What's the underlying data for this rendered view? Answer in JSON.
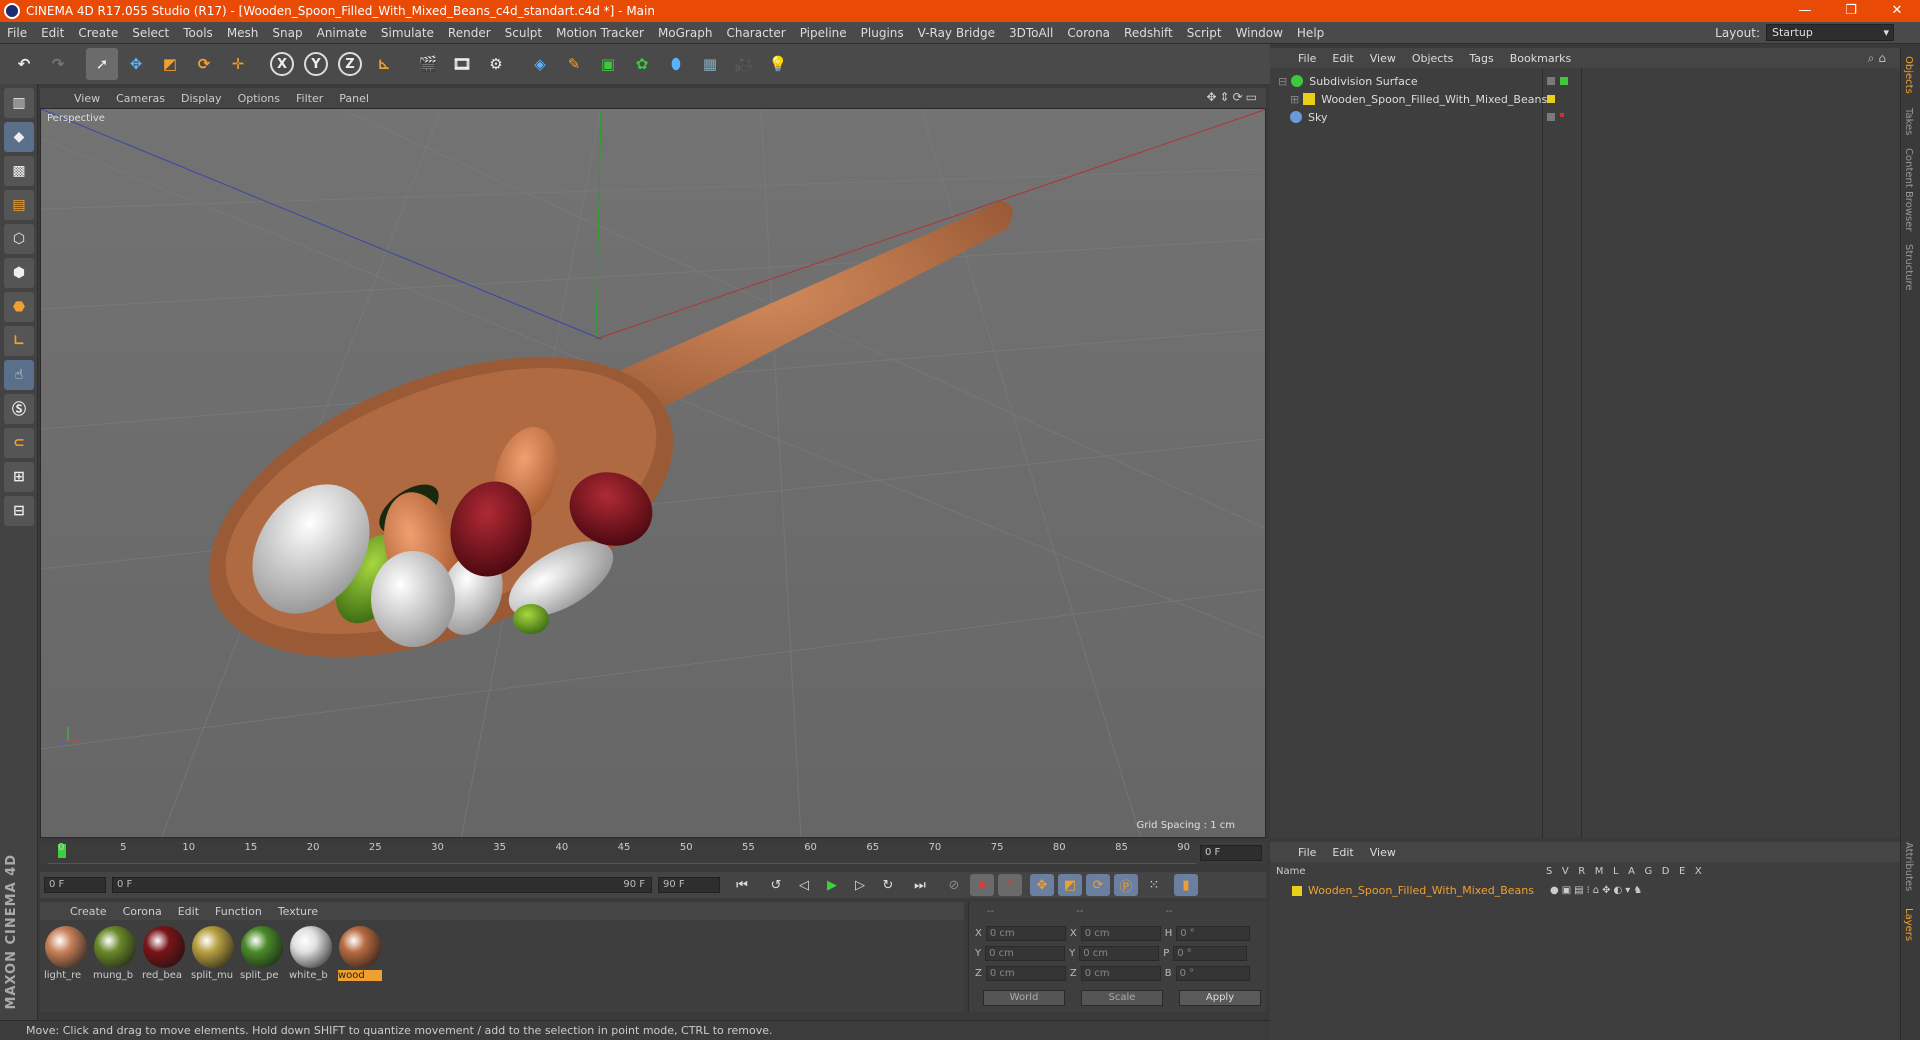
{
  "window": {
    "title": "CINEMA 4D R17.055 Studio (R17) - [Wooden_Spoon_Filled_With_Mixed_Beans_c4d_standart.c4d *] - Main",
    "controls": [
      "—",
      "❐",
      "✕"
    ]
  },
  "menu": [
    "File",
    "Edit",
    "Create",
    "Select",
    "Tools",
    "Mesh",
    "Snap",
    "Animate",
    "Simulate",
    "Render",
    "Sculpt",
    "Motion Tracker",
    "MoGraph",
    "Character",
    "Pipeline",
    "Plugins",
    "V-Ray Bridge",
    "3DToAll",
    "Corona",
    "Redshift",
    "Script",
    "Window",
    "Help"
  ],
  "layout": {
    "label": "Layout:",
    "value": "Startup"
  },
  "toolbar": {
    "axis_x": "X",
    "axis_y": "Y",
    "axis_z": "Z",
    "icons": [
      "undo-icon",
      "redo-icon",
      "select-icon",
      "move-icon",
      "scale-icon",
      "rotate-icon",
      "transform-icon",
      "coord-icon",
      "render-view-icon",
      "render-icon",
      "render-settings-icon",
      "cube-icon",
      "pen-icon",
      "subdivision-icon",
      "cloner-icon",
      "deformer-icon",
      "floor-icon",
      "camera-icon",
      "light-icon"
    ]
  },
  "viewport": {
    "menu": [
      "View",
      "Cameras",
      "Display",
      "Options",
      "Filter",
      "Panel"
    ],
    "label": "Perspective",
    "grid_spacing": "Grid Spacing : 1 cm"
  },
  "timeline": {
    "ticks": [
      "0",
      "5",
      "10",
      "15",
      "20",
      "25",
      "30",
      "35",
      "40",
      "45",
      "50",
      "55",
      "60",
      "65",
      "70",
      "75",
      "80",
      "85",
      "90"
    ],
    "frame": "0 F",
    "start": "0 F",
    "range_start": "0 F",
    "range_end": "90 F",
    "end": "90 F"
  },
  "material_manager": {
    "menu": [
      "Create",
      "Corona",
      "Edit",
      "Function",
      "Texture"
    ],
    "materials": [
      {
        "name": "light_re",
        "color": "#c8825a"
      },
      {
        "name": "mung_b",
        "color": "#6a8a2a"
      },
      {
        "name": "red_bea",
        "color": "#7a1418"
      },
      {
        "name": "split_mu",
        "color": "#b8a040"
      },
      {
        "name": "split_pe",
        "color": "#4a8a2a"
      },
      {
        "name": "white_b",
        "color": "#e0e0e0"
      },
      {
        "name": "wood",
        "color": "#b86a40"
      }
    ]
  },
  "coordinates": {
    "headers": [
      "--",
      "--",
      "--"
    ],
    "rows": [
      {
        "a": "X",
        "av": "0 cm",
        "b": "X",
        "bv": "0 cm",
        "c": "H",
        "cv": "0 °"
      },
      {
        "a": "Y",
        "av": "0 cm",
        "b": "Y",
        "bv": "0 cm",
        "c": "P",
        "cv": "0 °"
      },
      {
        "a": "Z",
        "av": "0 cm",
        "b": "Z",
        "bv": "0 cm",
        "c": "B",
        "cv": "0 °"
      }
    ],
    "world": "World",
    "scale": "Scale",
    "apply": "Apply"
  },
  "status": "Move: Click and drag to move elements. Hold down SHIFT to quantize movement / add to the selection in point mode, CTRL to remove.",
  "brand": "MAXON CINEMA 4D",
  "object_manager": {
    "menu": [
      "File",
      "Edit",
      "View",
      "Objects",
      "Tags",
      "Bookmarks"
    ],
    "objects": [
      {
        "name": "Subdivision Surface",
        "color": "#3ec83e"
      },
      {
        "name": "Wooden_Spoon_Filled_With_Mixed_Beans",
        "color": "#e8d01a"
      },
      {
        "name": "Sky",
        "color": "#6a9ad8"
      }
    ]
  },
  "layer_manager": {
    "menu": [
      "File",
      "Edit",
      "View"
    ],
    "columns": [
      "Name",
      "S",
      "V",
      "R",
      "M",
      "L",
      "A",
      "G",
      "D",
      "E",
      "X"
    ],
    "layer": "Wooden_Spoon_Filled_With_Mixed_Beans",
    "layer_color": "#e8d01a"
  },
  "right_tabs": [
    "Objects",
    "Takes",
    "Content Browser",
    "Structure",
    "Attributes",
    "Layers"
  ]
}
